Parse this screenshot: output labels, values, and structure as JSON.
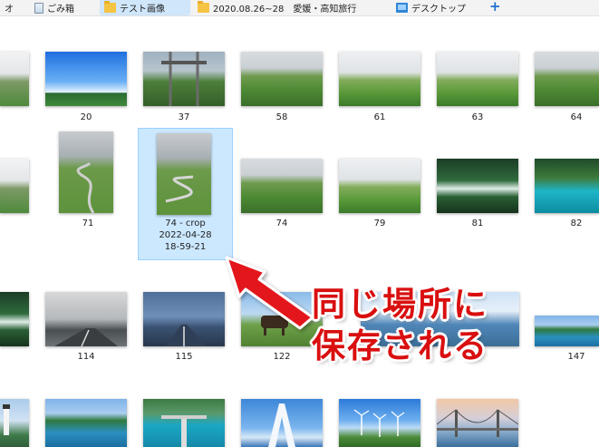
{
  "tabs": [
    {
      "label": "オ",
      "icon": "partial-tab"
    },
    {
      "label": "ごみ箱",
      "icon": "trash-icon"
    },
    {
      "label": "テスト画像",
      "icon": "folder-icon",
      "active": true
    },
    {
      "label": "2020.08.26~28　愛媛・高知旅行",
      "icon": "folder-icon"
    },
    {
      "label": "デスクトップ",
      "icon": "desktop-icon"
    }
  ],
  "new_tab_label": "+",
  "files": {
    "row1": [
      "20",
      "37",
      "58",
      "61",
      "63",
      "64"
    ],
    "row2": [
      "71",
      "74",
      "79",
      "81",
      "82"
    ],
    "row3": [
      "114",
      "115",
      "122",
      "147"
    ]
  },
  "selected": {
    "line1": "74 - crop",
    "line2": "2022-04-28",
    "line3": "18-59-21"
  },
  "annotation": {
    "line1": "同じ場所に",
    "line2": "保存される",
    "color": "#d90f0f"
  },
  "colors": {
    "selection_bg": "#cce8ff",
    "selection_border": "#99d1ff",
    "active_tab": "#cfe6fb"
  }
}
